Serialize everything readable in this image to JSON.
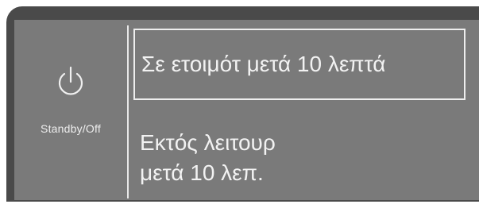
{
  "standby": {
    "label": "Standby/Off",
    "icon": "power-icon"
  },
  "menu": {
    "items": [
      {
        "label": "Σε ετοιμότ μετά 10 λεπτά",
        "selected": true
      },
      {
        "label": "Εκτός λειτουρ μετά 10 λεπ.",
        "selected": false
      }
    ]
  },
  "colors": {
    "frame": "#4a4a4a",
    "screen": "#7a7a7a",
    "text": "#f2f2f2"
  }
}
